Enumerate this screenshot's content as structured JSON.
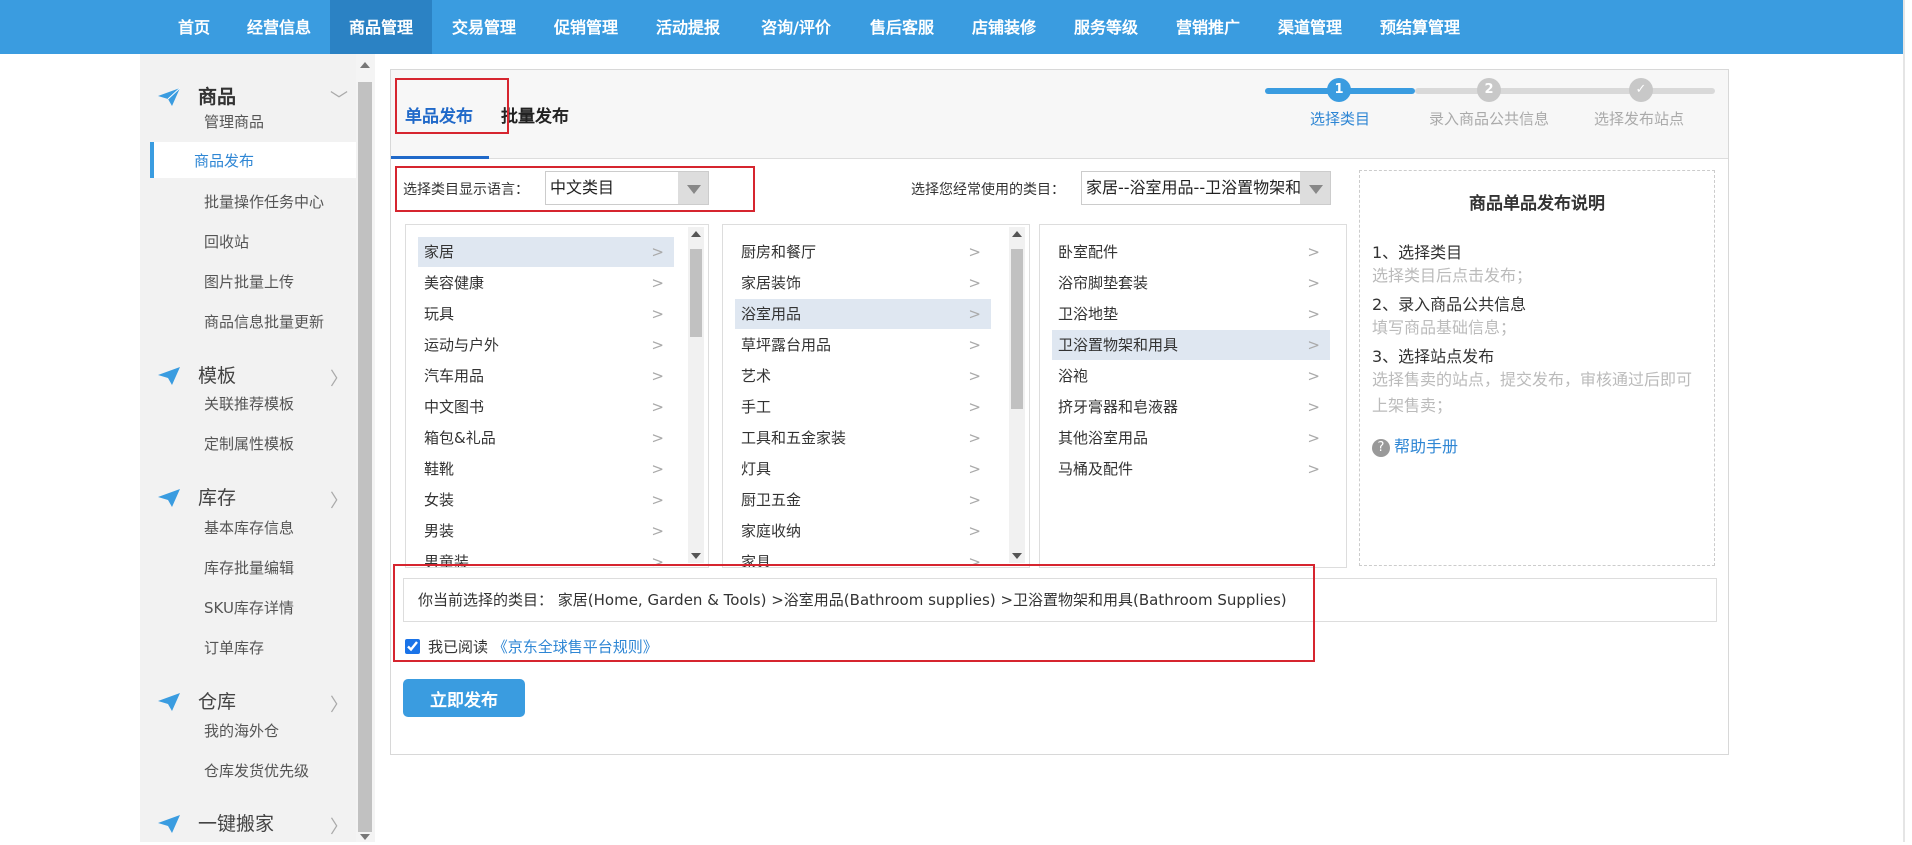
{
  "topnav": {
    "items": [
      "首页",
      "经营信息",
      "商品管理",
      "交易管理",
      "促销管理",
      "活动提报",
      "咨询/评价",
      "售后客服",
      "店铺装修",
      "服务等级",
      "营销推广",
      "渠道管理",
      "预结算管理"
    ],
    "active_index": 2
  },
  "sidebar": {
    "groups": [
      {
        "title": "商品",
        "links": [
          "管理商品",
          "商品发布",
          "批量操作任务中心",
          "回收站",
          "图片批量上传",
          "商品信息批量更新"
        ]
      },
      {
        "title": "模板",
        "links": [
          "关联推荐模板",
          "定制属性模板"
        ]
      },
      {
        "title": "库存",
        "links": [
          "基本库存信息",
          "库存批量编辑",
          "SKU库存详情",
          "订单库存"
        ]
      },
      {
        "title": "仓库",
        "links": [
          "我的海外仓",
          "仓库发货优先级"
        ]
      },
      {
        "title": "一键搬家",
        "links": []
      }
    ],
    "active_link": "商品发布"
  },
  "tabs": [
    "单品发布",
    "批量发布"
  ],
  "steps": [
    {
      "num": "1",
      "label": "选择类目"
    },
    {
      "num": "2",
      "label": "录入商品公共信息"
    },
    {
      "num": "✓",
      "label": "选择发布站点"
    }
  ],
  "language": {
    "label": "选择类目显示语言：",
    "value": "中文类目"
  },
  "frequent": {
    "label": "选择您经常使用的类目：",
    "value": "家居--浴室用品--卫浴置物架和"
  },
  "columns": [
    {
      "items": [
        "家居",
        "美容健康",
        "玩具",
        "运动与户外",
        "汽车用品",
        "中文图书",
        "箱包&礼品",
        "鞋靴",
        "女装",
        "男装",
        "男童装"
      ],
      "selected": 0
    },
    {
      "items": [
        "厨房和餐厅",
        "家居装饰",
        "浴室用品",
        "草坪露台用品",
        "艺术",
        "手工",
        "工具和五金家装",
        "灯具",
        "厨卫五金",
        "家庭收纳",
        "家具"
      ],
      "selected": 2
    },
    {
      "items": [
        "卧室配件",
        "浴帘脚垫套装",
        "卫浴地垫",
        "卫浴置物架和用具",
        "浴袍",
        "挤牙膏器和皂液器",
        "其他浴室用品",
        "马桶及配件"
      ],
      "selected": 3
    }
  ],
  "arrow_glyph": ">",
  "info": {
    "title": "商品单品发布说明",
    "steps": [
      {
        "title": "1、选择类目",
        "desc": "选择类目后点击发布；"
      },
      {
        "title": "2、录入商品公共信息",
        "desc": "填写商品基础信息；"
      },
      {
        "title": "3、选择站点发布",
        "desc": "选择售卖的站点，提交发布，审核通过后即可上架售卖；"
      }
    ],
    "help": "帮助手册"
  },
  "current_selection": "你当前选择的类目：  家居(Home, Garden & Tools) >浴室用品(Bathroom supplies) >卫浴置物架和用具(Bathroom Supplies)",
  "agree": {
    "prefix": "我已阅读",
    "link": "《京东全球售平台规则》",
    "checked": true
  },
  "publish_button": "立即发布",
  "colors": {
    "nav": "#3a9ce0",
    "nav_active": "#2b82c4",
    "accent": "#2069c9",
    "link": "#2e86d4",
    "highlight_box": "#d6252f"
  }
}
